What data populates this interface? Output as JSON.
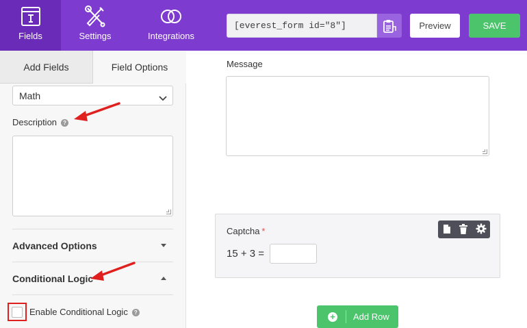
{
  "colors": {
    "accent": "#7e3bd0",
    "accent_dark": "#6a2bb9",
    "save_green": "#4cc46c",
    "annotation_red": "#e01f1f"
  },
  "topnav": {
    "items": [
      {
        "label": "Fields",
        "icon": "fields-icon",
        "active": true
      },
      {
        "label": "Settings",
        "icon": "settings-tools-icon",
        "active": false
      },
      {
        "label": "Integrations",
        "icon": "integrations-rings-icon",
        "active": false
      }
    ],
    "shortcode": "[everest_form id=\"8\"]",
    "copy_icon": "clipboard-copy-icon",
    "preview_label": "Preview",
    "save_label": "SAVE"
  },
  "sidebar": {
    "tabs": [
      {
        "label": "Add Fields",
        "active": false
      },
      {
        "label": "Field Options",
        "active": true
      }
    ],
    "type_select": {
      "value": "Math"
    },
    "description_label": "Description",
    "sections": [
      {
        "label": "Advanced Options",
        "state": "collapsed"
      },
      {
        "label": "Conditional Logic",
        "state": "expanded"
      }
    ],
    "enable_conditional_logic": {
      "label": "Enable Conditional Logic",
      "checked": false
    }
  },
  "canvas": {
    "message_label": "Message",
    "captcha": {
      "label": "Captcha",
      "required_mark": "*",
      "question": "15 + 3 ="
    },
    "captcha_toolbar_icons": [
      "duplicate-icon",
      "trash-icon",
      "gear-icon"
    ],
    "add_row_label": "Add Row"
  }
}
